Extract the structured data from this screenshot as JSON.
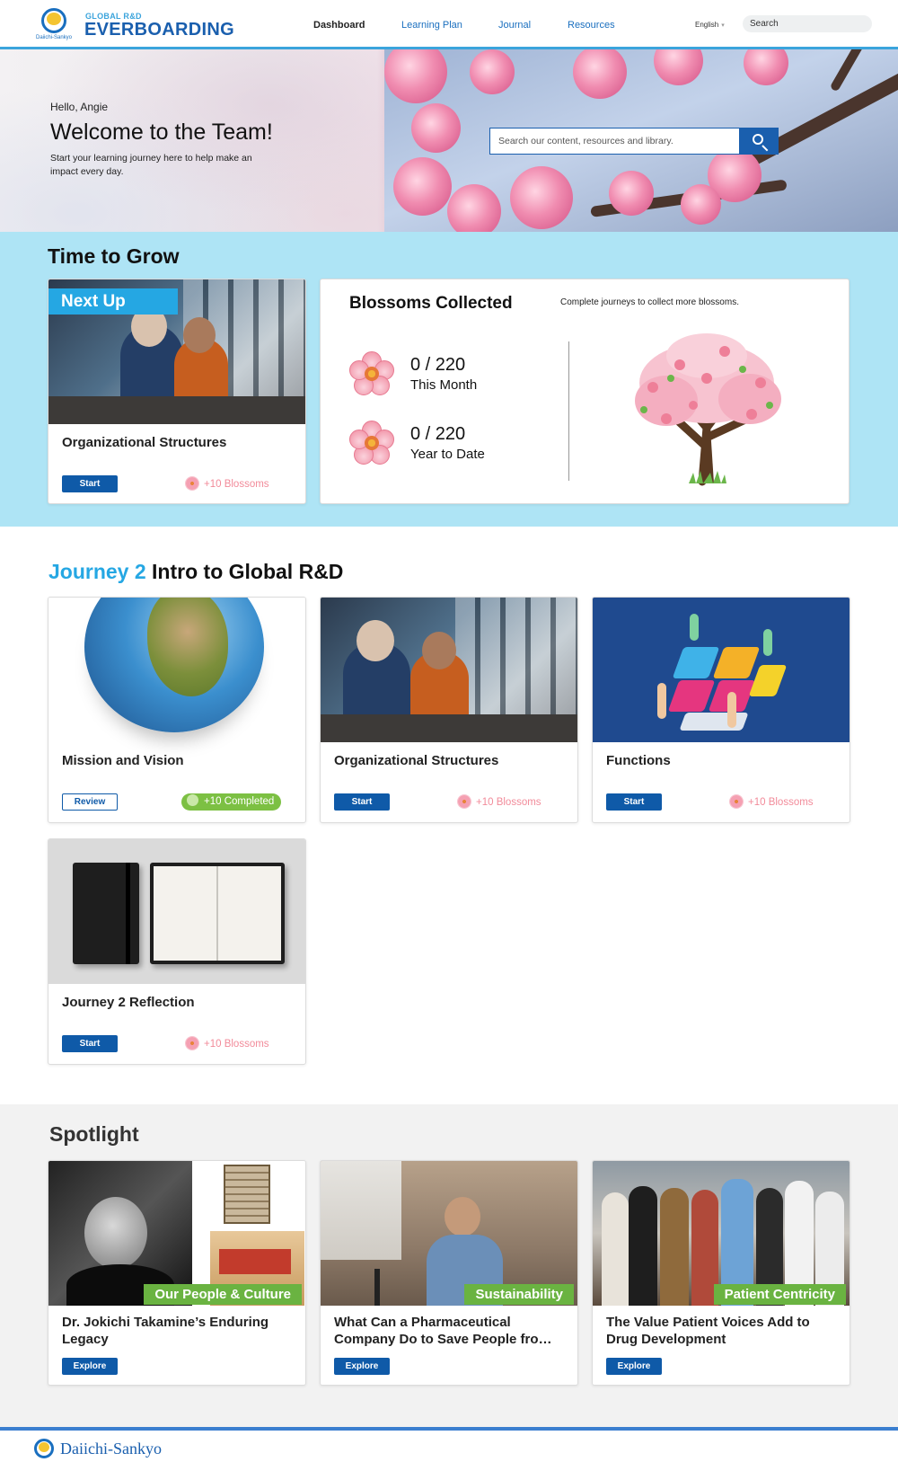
{
  "header": {
    "logo_text": "Daiichi-Sankyo",
    "brand_sub": "GLOBAL R&D",
    "brand_main": "EVERBOARDING",
    "nav": {
      "dashboard": "Dashboard",
      "learning_plan": "Learning Plan",
      "journal": "Journal",
      "resources": "Resources"
    },
    "language": "English",
    "search_placeholder": "Search"
  },
  "hero": {
    "greeting": "Hello, Angie",
    "title": "Welcome to the Team!",
    "description": "Start your learning journey here to help make an impact every day.",
    "search_placeholder": "Search our content, resources and library."
  },
  "grow": {
    "title": "Time to Grow",
    "next_up": {
      "badge": "Next Up",
      "title": "Organizational Structures",
      "button": "Start",
      "reward": "+10 Blossoms"
    },
    "blossoms": {
      "title": "Blossoms Collected",
      "subtitle": "Complete journeys to collect more blossoms.",
      "month_count": "0 / 220",
      "month_label": "This Month",
      "ytd_count": "0 / 220",
      "ytd_label": "Year to Date"
    }
  },
  "journey": {
    "number": "Journey 2",
    "name": "Intro to Global R&D",
    "cards": [
      {
        "title": "Mission and Vision",
        "button": "Review",
        "reward": "+10 Completed"
      },
      {
        "title": "Organizational Structures",
        "button": "Start",
        "reward": "+10 Blossoms"
      },
      {
        "title": "Functions",
        "button": "Start",
        "reward": "+10 Blossoms"
      },
      {
        "title": "Journey 2 Reflection",
        "button": "Start",
        "reward": "+10 Blossoms"
      }
    ]
  },
  "spotlight": {
    "title": "Spotlight",
    "cards": [
      {
        "tag": "Our People & Culture",
        "title": "Dr. Jokichi Takamine’s Enduring Legacy",
        "button": "Explore"
      },
      {
        "tag": "Sustainability",
        "title": "What Can a Pharmaceutical Company Do to Save People fro…",
        "button": "Explore"
      },
      {
        "tag": "Patient Centricity",
        "title": "The Value Patient Voices Add to Drug Development",
        "button": "Explore"
      }
    ]
  },
  "footer": {
    "logo_text": "Daiichi-Sankyo"
  },
  "colors": {
    "brand_blue": "#1a5fae",
    "accent_cyan": "#25a7e3",
    "grow_bg": "#aee4f5",
    "reward_pink": "#f28b9a",
    "completed_green": "#7cc043",
    "tag_green": "#6ab341"
  }
}
